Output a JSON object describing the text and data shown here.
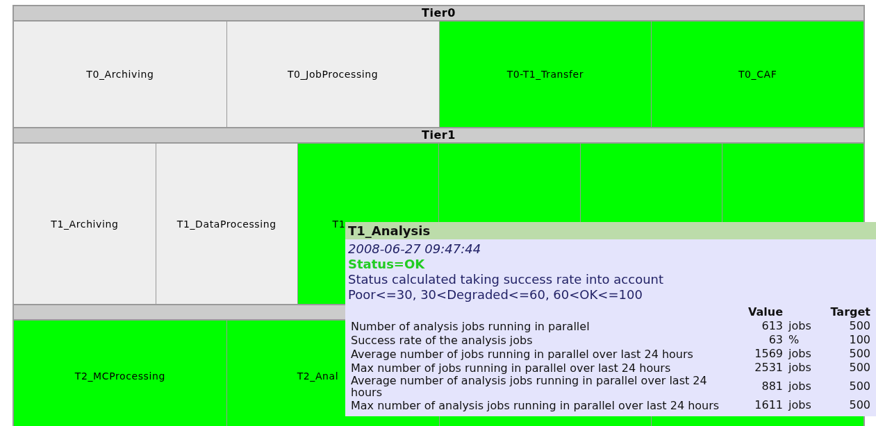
{
  "tiers": [
    {
      "title": "Tier0",
      "cells": [
        {
          "label": "T0_Archiving",
          "color": "#eeeeee"
        },
        {
          "label": "T0_JobProcessing",
          "color": "#eeeeee"
        },
        {
          "label": "T0-T1_Transfer",
          "color": "#00ff00"
        },
        {
          "label": "T0_CAF",
          "color": "#00ff00"
        }
      ]
    },
    {
      "title": "Tier1",
      "cells": [
        {
          "label": "T1_Archiving",
          "color": "#eeeeee"
        },
        {
          "label": "T1_DataProcessing",
          "color": "#eeeeee"
        },
        {
          "label": "T1",
          "color": "#00ff00",
          "kind": "covered"
        },
        {
          "color": "#00ff00"
        },
        {
          "color": "#00ff00"
        },
        {
          "color": "#00ff00"
        }
      ]
    },
    {
      "cells": [
        {
          "label": "T2_MCProcessing",
          "color": "#00ff00"
        },
        {
          "label": "T2_Anal",
          "color": "#00ff00",
          "kind": "covered"
        },
        {
          "color": "#00ff00"
        },
        {
          "color": "#00ff00"
        }
      ]
    }
  ],
  "tooltip": {
    "title": "T1_Analysis",
    "timestamp": "2008-06-27 09:47:44",
    "status": "Status=OK",
    "description": "Status calculated taking success rate into account",
    "thresholds": "Poor<=30, 30<Degraded<=60, 60<OK<=100",
    "columns": [
      "Value",
      "Target"
    ],
    "rows": [
      {
        "metric": "Number of analysis jobs running in parallel",
        "value": "613",
        "unit": "jobs",
        "target": "500"
      },
      {
        "metric": "Success rate of the analysis jobs",
        "value": "63",
        "unit": "%",
        "target": "100"
      },
      {
        "metric": "Average number of jobs running in parallel over last 24 hours",
        "value": "1569",
        "unit": "jobs",
        "target": "500"
      },
      {
        "metric": "Max number of jobs running in parallel over last 24 hours",
        "value": "2531",
        "unit": "jobs",
        "target": "500"
      },
      {
        "metric": "Average number of analysis jobs running in parallel over last 24 hours",
        "value": "881",
        "unit": "jobs",
        "target": "500"
      },
      {
        "metric": "Max number of analysis jobs running in parallel over last 24 hours",
        "value": "1611",
        "unit": "jobs",
        "target": "500"
      }
    ]
  }
}
